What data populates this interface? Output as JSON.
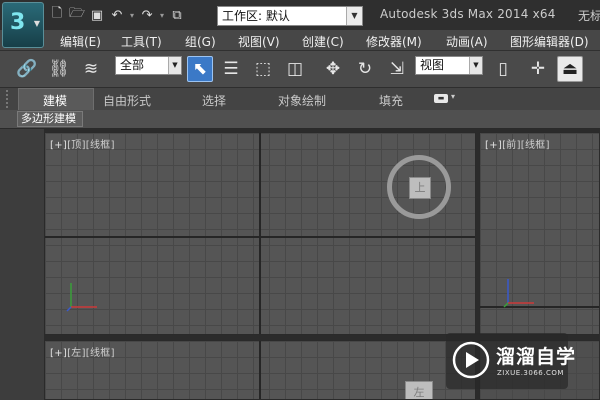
{
  "titlebar": {
    "app_title": "Autodesk 3ds Max  2014 x64",
    "doc_title_partial": "无标",
    "workspace_label": "工作区: 默认"
  },
  "menu": {
    "items": [
      "编辑(E)",
      "工具(T)",
      "组(G)",
      "视图(V)",
      "创建(C)",
      "修改器(M)",
      "动画(A)",
      "图形编辑器(D)"
    ]
  },
  "toolbar": {
    "selection_filter": "全部",
    "reference_coord": "视图"
  },
  "ribbon": {
    "tabs": [
      "建模",
      "自由形式",
      "选择",
      "对象绘制",
      "填充"
    ],
    "active_tab": "建模",
    "panel_button": "多边形建模"
  },
  "viewports": {
    "top": {
      "plus": "[+]",
      "view": "[顶]",
      "shading": "[线框]"
    },
    "front": {
      "plus": "[+]",
      "view": "[前]",
      "shading": "[线框]"
    },
    "left": {
      "plus": "[+]",
      "view": "[左]",
      "shading": "[线框]"
    },
    "viewcube_top_face": "上",
    "viewcube_left_face": "左"
  },
  "watermark": {
    "text": "溜溜自学",
    "url": "ZIXUE.3066.COM"
  },
  "colors": {
    "title_bg": "#2f2f2f",
    "menu_bg": "#474747",
    "toolbar_bg": "#4a4a4a",
    "viewport_bg": "#555555",
    "grid_line": "#484848",
    "axis_line": "#262626",
    "active_button": "#3b79c7",
    "logo_accent": "#7fe6ef"
  }
}
